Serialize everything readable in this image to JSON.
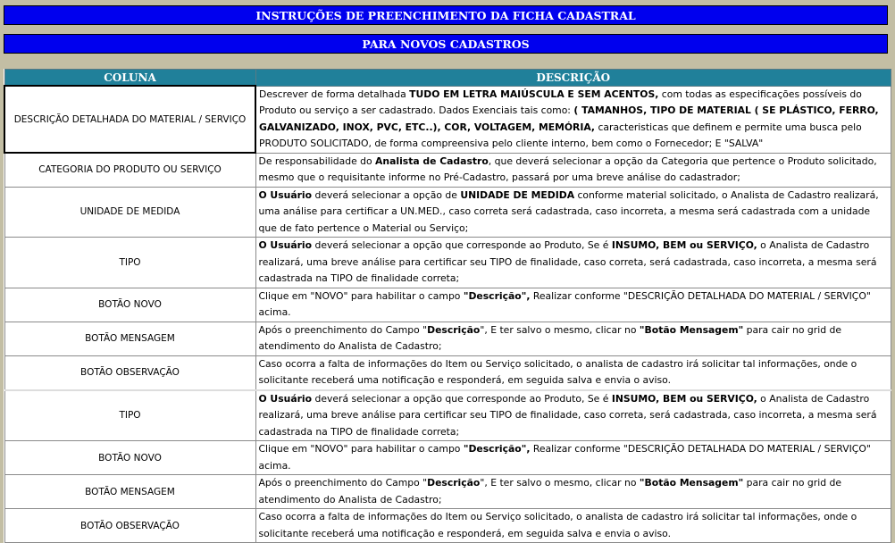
{
  "header": {
    "title": "INSTRUÇÕES DE PREENCHIMENTO DA FICHA CADASTRAL",
    "subtitle": "PARA NOVOS CADASTROS"
  },
  "table": {
    "col_coluna": "COLUNA",
    "col_descricao": "DESCRIÇÃO",
    "rows": [
      {
        "coluna": "DESCRIÇÃO DETALHADA DO MATERIAL / SERVIÇO",
        "parts": [
          {
            "t": "Descrever de forma detalhada "
          },
          {
            "t": "TUDO EM LETRA MAIÚSCULA E SEM ACENTOS,",
            "b": true
          },
          {
            "t": " com todas as especificações possíveis do Produto ou serviço a ser cadastrado. Dados Exenciais tais como: "
          },
          {
            "t": "( TAMANHOS, TIPO DE MATERIAL ( SE PLÁSTICO, FERRO, GALVANIZADO, INOX, PVC, ETC..), COR, VOLTAGEM, MEMÓRIA,",
            "b": true
          },
          {
            "t": " caracteristicas que definem e permite uma busca pelo PRODUTO SOLICITADO, de forma compreensiva pelo cliente interno, bem como o Fornecedor; E \"SALVA\""
          }
        ]
      },
      {
        "coluna": "CATEGORIA DO PRODUTO OU SERVIÇO",
        "parts": [
          {
            "t": "De responsabilidade do "
          },
          {
            "t": "Analista de Cadastro",
            "b": true
          },
          {
            "t": ", que deverá selecionar a opção da Categoria que pertence o Produto solicitado, mesmo que o requisitante informe no Pré-Cadastro, passará por uma breve análise do cadastrador;"
          }
        ]
      },
      {
        "coluna": "UNIDADE DE MEDIDA",
        "parts": [
          {
            "t": "O Usuário",
            "b": true
          },
          {
            "t": " deverá selecionar a opção de "
          },
          {
            "t": "UNIDADE DE MEDIDA",
            "b": true
          },
          {
            "t": " conforme material solicitado, o Analista de Cadastro realizará, uma análise para certificar a UN.MED., caso correta será cadastrada, caso incorreta, a mesma será cadastrada com a unidade que de fato pertence o Material ou Serviço;"
          }
        ]
      },
      {
        "coluna": "TIPO",
        "parts": [
          {
            "t": "O Usuário",
            "b": true
          },
          {
            "t": " deverá selecionar a opção que corresponde ao Produto, Se é "
          },
          {
            "t": "INSUMO, BEM ou SERVIÇO,",
            "b": true
          },
          {
            "t": " o Analista de Cadastro realizará, uma breve análise para certificar seu TIPO de finalidade, caso correta, será cadastrada, caso incorreta, a mesma será cadastrada na TIPO de finalidade correta;"
          }
        ]
      },
      {
        "coluna": "BOTÃO NOVO",
        "parts": [
          {
            "t": "Clique em \"NOVO\" para habilitar o campo "
          },
          {
            "t": "\"Descrição\",",
            "b": true
          },
          {
            "t": "  Realizar conforme \"DESCRIÇÃO DETALHADA DO MATERIAL / SERVIÇO\" acima."
          }
        ]
      },
      {
        "coluna": "BOTÃO MENSAGEM",
        "parts": [
          {
            "t": "Após o preenchimento do Campo \""
          },
          {
            "t": "Descrição",
            "b": true
          },
          {
            "t": "\", E ter salvo o mesmo, clicar no "
          },
          {
            "t": "\"Botão Mensagem\"",
            "b": true
          },
          {
            "t": " para cair no grid de atendimento do Analista de Cadastro;"
          }
        ]
      },
      {
        "coluna": "BOTÃO OBSERVAÇÃO",
        "parts": [
          {
            "t": "Caso ocorra a falta de informações do Item ou Serviço solicitado, o analista de cadastro irá solicitar tal informações, onde o solicitante receberá uma notificação e responderá, em seguida salva e envia o aviso."
          }
        ]
      },
      {
        "coluna": "TIPO",
        "parts": [
          {
            "t": "O Usuário",
            "b": true
          },
          {
            "t": " deverá selecionar a opção que corresponde ao Produto, Se é "
          },
          {
            "t": "INSUMO, BEM ou SERVIÇO,",
            "b": true
          },
          {
            "t": " o Analista de Cadastro realizará, uma breve análise para certificar seu TIPO de finalidade, caso correta, será cadastrada, caso incorreta, a mesma será cadastrada na TIPO de finalidade correta;"
          }
        ]
      },
      {
        "coluna": "BOTÃO NOVO",
        "parts": [
          {
            "t": "Clique em \"NOVO\" para habilitar o campo "
          },
          {
            "t": "\"Descrição\",",
            "b": true
          },
          {
            "t": "  Realizar conforme \"DESCRIÇÃO DETALHADA DO MATERIAL / SERVIÇO\" acima."
          }
        ]
      },
      {
        "coluna": "BOTÃO MENSAGEM",
        "parts": [
          {
            "t": "Após o preenchimento do Campo \""
          },
          {
            "t": "Descrição",
            "b": true
          },
          {
            "t": "\", E ter salvo o mesmo, clicar no "
          },
          {
            "t": "\"Botão Mensagem\"",
            "b": true
          },
          {
            "t": " para cair no grid de atendimento do Analista de Cadastro;"
          }
        ]
      },
      {
        "coluna": "BOTÃO OBSERVAÇÃO",
        "parts": [
          {
            "t": "Caso ocorra a falta de informações do Item ou Serviço solicitado, o analista de cadastro irá solicitar tal informações, onde o solicitante receberá uma notificação e responderá, em seguida salva e envia o aviso."
          }
        ]
      }
    ]
  }
}
